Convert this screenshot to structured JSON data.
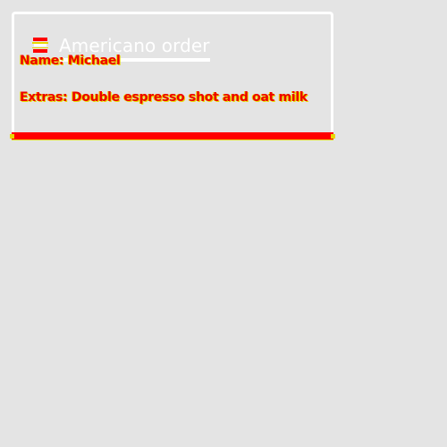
{
  "card": {
    "title": "Americano order",
    "icon": "coffee-cup-icon",
    "fields": {
      "name": "Name: Michael",
      "extras": "Extras: Double espresso shot and oat milk"
    }
  },
  "colors": {
    "background": "#e4e4e4",
    "accent": "#ff0000",
    "highlight": "#e8d800",
    "text_light": "#ffffff"
  }
}
